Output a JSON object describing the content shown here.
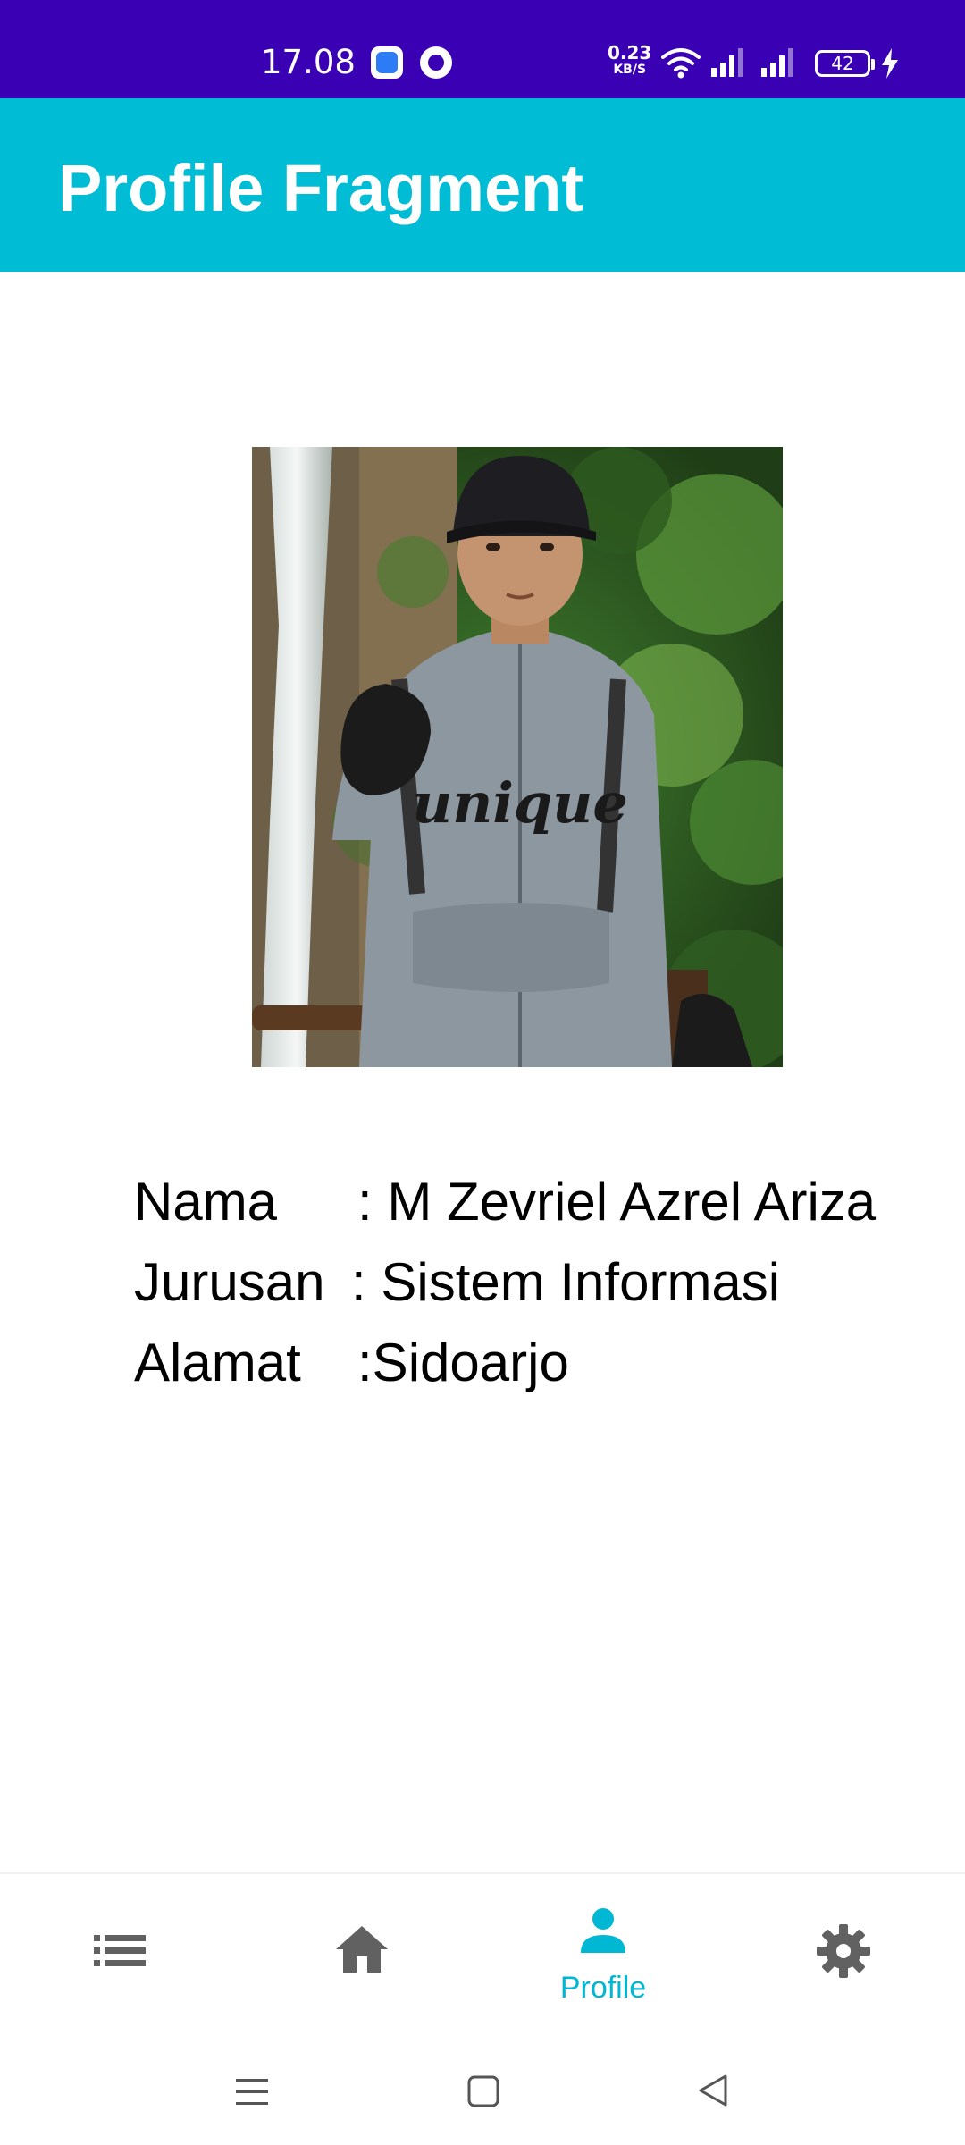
{
  "status_bar": {
    "time": "17.08",
    "net_speed_value": "0.23",
    "net_speed_unit": "KB/S",
    "battery": "42"
  },
  "app_bar": {
    "title": "Profile Fragment"
  },
  "profile": {
    "rows": [
      {
        "label": "Nama",
        "value": ": M Zevriel Azrel Ariza"
      },
      {
        "label": "Jurusan",
        "value": ": Sistem Informasi"
      },
      {
        "label": "Alamat",
        "value": ":Sidoarjo"
      }
    ]
  },
  "bottom_nav": {
    "items": [
      {
        "icon": "list-icon",
        "label": "",
        "selected": false
      },
      {
        "icon": "home-icon",
        "label": "",
        "selected": false
      },
      {
        "icon": "person-icon",
        "label": "Profile",
        "selected": true
      },
      {
        "icon": "settings-gear-icon",
        "label": "",
        "selected": false
      }
    ]
  },
  "colors": {
    "status_bar": "#3a00b4",
    "app_bar": "#00bcd4",
    "nav_selected": "#00b8d4",
    "nav_unselected": "#616161"
  }
}
